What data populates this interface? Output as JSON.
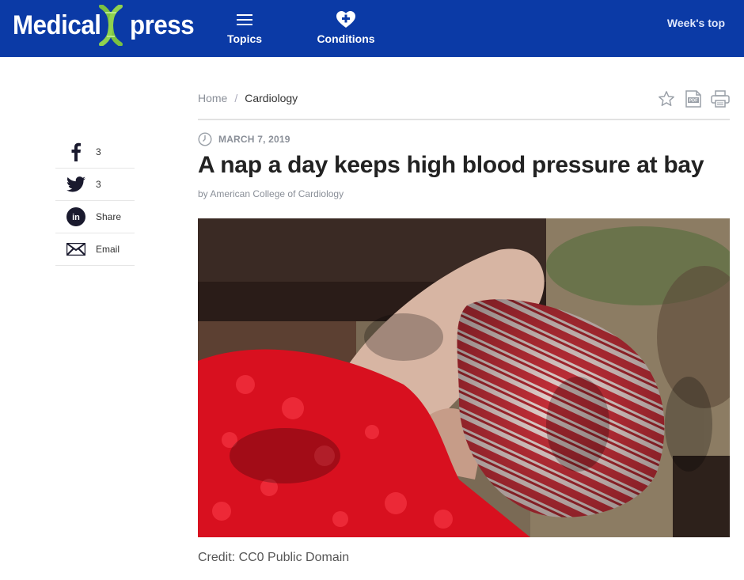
{
  "header": {
    "logo_left": "Medical",
    "logo_right": "press",
    "nav": [
      {
        "label": "Topics",
        "icon": "menu-icon"
      },
      {
        "label": "Conditions",
        "icon": "heart-plus-icon"
      }
    ],
    "weeks_top": "Week's top",
    "colors": {
      "bar": "#0b3aa6",
      "logo_x": "#7ac142"
    }
  },
  "share": [
    {
      "icon": "facebook-icon",
      "label": "3"
    },
    {
      "icon": "twitter-icon",
      "label": "3"
    },
    {
      "icon": "linkedin-icon",
      "label": "Share"
    },
    {
      "icon": "email-icon",
      "label": "Email"
    }
  ],
  "breadcrumb": {
    "home": "Home",
    "separator": "/",
    "current": "Cardiology"
  },
  "tools": [
    "star-icon",
    "pdf-icon",
    "print-icon"
  ],
  "article": {
    "date": "MARCH 7, 2019",
    "title": "A nap a day keeps high blood pressure at bay",
    "byline": "by American College of Cardiology",
    "caption": "Credit: CC0 Public Domain"
  }
}
